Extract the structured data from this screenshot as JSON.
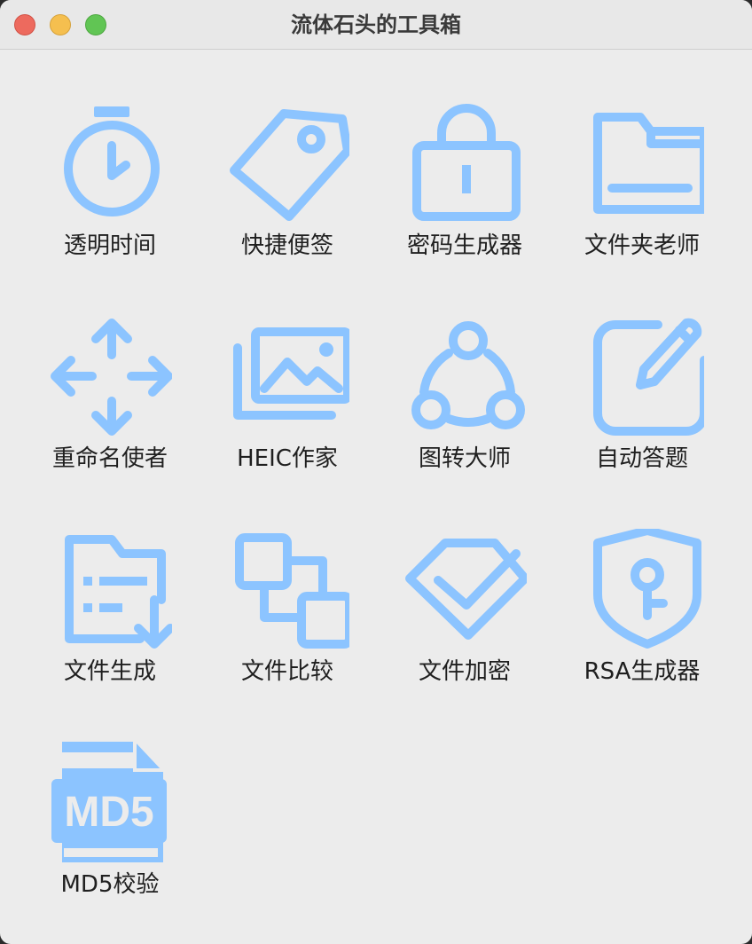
{
  "window": {
    "title": "流体石头的工具箱"
  },
  "accent_color": "#8cc4ff",
  "tools": [
    {
      "label": "透明时间",
      "icon": "stopwatch-icon"
    },
    {
      "label": "快捷便签",
      "icon": "tag-icon"
    },
    {
      "label": "密码生成器",
      "icon": "lock-icon"
    },
    {
      "label": "文件夹老师",
      "icon": "folder-icon"
    },
    {
      "label": "重命名使者",
      "icon": "move-arrows-icon"
    },
    {
      "label": "HEIC作家",
      "icon": "photo-stack-icon"
    },
    {
      "label": "图转大师",
      "icon": "share-nodes-icon"
    },
    {
      "label": "自动答题",
      "icon": "edit-square-icon"
    },
    {
      "label": "文件生成",
      "icon": "file-list-download-icon"
    },
    {
      "label": "文件比较",
      "icon": "compare-squares-icon"
    },
    {
      "label": "文件加密",
      "icon": "shield-check-icon"
    },
    {
      "label": "RSA生成器",
      "icon": "key-shield-icon"
    },
    {
      "label": "MD5校验",
      "icon": "md5-file-icon"
    }
  ],
  "md5_badge_text": "MD5"
}
